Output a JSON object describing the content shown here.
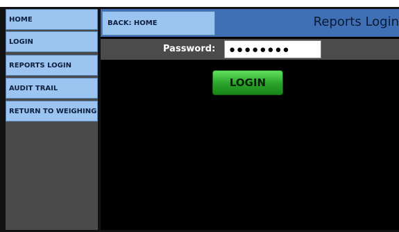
{
  "sidebar": {
    "items": [
      {
        "label": "HOME"
      },
      {
        "label": "LOGIN"
      },
      {
        "label": "REPORTS LOGIN"
      },
      {
        "label": "AUDIT TRAIL"
      },
      {
        "label": "RETURN TO WEIGHING"
      }
    ]
  },
  "header": {
    "back_label": "BACK: HOME",
    "title": "Reports Login"
  },
  "password": {
    "label": "Password:",
    "value": "●●●●●●●●"
  },
  "login_button": {
    "label": "LOGIN"
  },
  "colors": {
    "nav_button": "#9bc4f1",
    "header_bar": "#3f70b6",
    "login_green": "#2aa12a",
    "background": "#000000"
  }
}
